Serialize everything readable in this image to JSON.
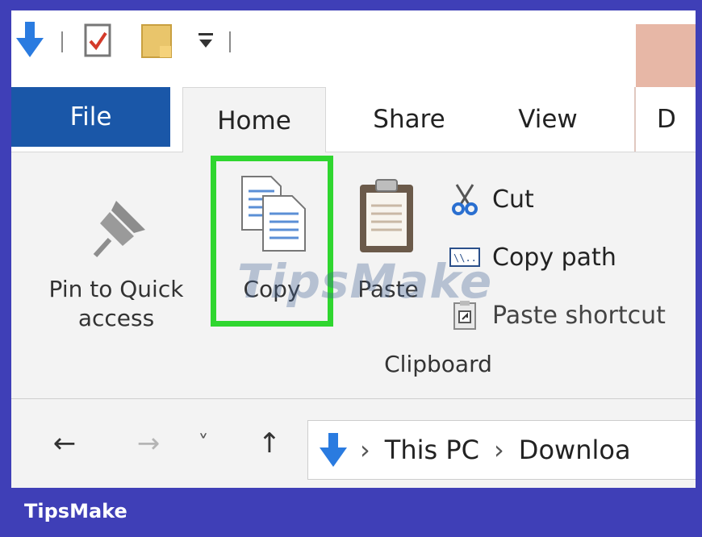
{
  "quick_access_toolbar": {
    "icons": [
      "download-arrow-icon",
      "properties-icon",
      "new-folder-icon",
      "customize-toolbar-icon"
    ]
  },
  "tabs": {
    "file": "File",
    "home": "Home",
    "share": "Share",
    "view": "View",
    "partial": "D"
  },
  "ribbon": {
    "pin_label_line1": "Pin to Quick",
    "pin_label_line2": "access",
    "copy_label": "Copy",
    "paste_label": "Paste",
    "cut_label": "Cut",
    "copy_path_label": "Copy path",
    "paste_shortcut_label": "Paste shortcut",
    "group_label": "Clipboard"
  },
  "navigation": {
    "back": "←",
    "forward": "→",
    "recent": "˅",
    "up": "↑",
    "path": [
      "This PC",
      "Downloa"
    ],
    "separator": "›"
  },
  "watermark": "TipsMake",
  "footer": "TipsMake",
  "colors": {
    "background": "#3f3fb7",
    "file_tab": "#1a57a8",
    "highlight": "#2fd62f",
    "accent": "#e7b7a6"
  }
}
